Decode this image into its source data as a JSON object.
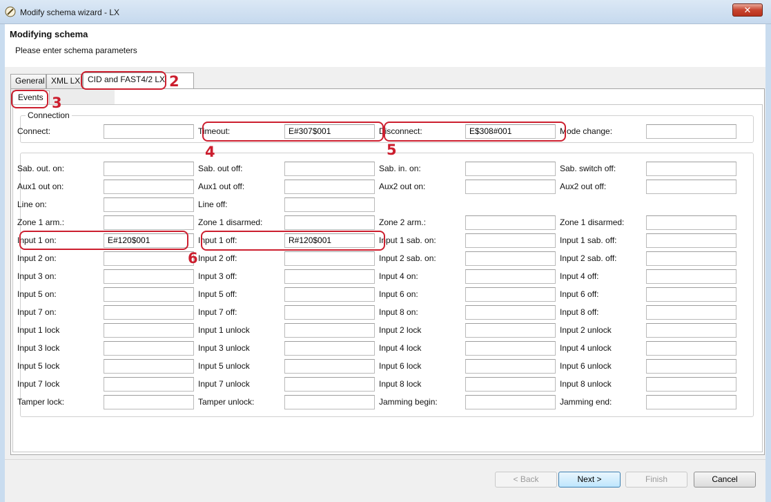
{
  "window": {
    "title": "Modify schema wizard - LX",
    "close_label": "✕"
  },
  "header": {
    "title": "Modifying schema",
    "subtitle": "Please enter schema parameters"
  },
  "tabs": [
    "General",
    "XML LX",
    "CID and FAST4/2 LX"
  ],
  "subtab": "Events",
  "connection": {
    "legend": "Connection",
    "fields": [
      {
        "label": "Connect:",
        "value": ""
      },
      {
        "label": "Timeout:",
        "value": "E#307$001"
      },
      {
        "label": "Disconnect:",
        "value": "E$308#001"
      },
      {
        "label": "Mode change:",
        "value": ""
      }
    ]
  },
  "events": [
    [
      {
        "label": "Sab. out. on:",
        "value": ""
      },
      {
        "label": "Sab. out off:",
        "value": ""
      },
      {
        "label": "Sab. in. on:",
        "value": ""
      },
      {
        "label": "Sab. switch off:",
        "value": ""
      }
    ],
    [
      {
        "label": "Aux1 out on:",
        "value": ""
      },
      {
        "label": "Aux1 out off:",
        "value": ""
      },
      {
        "label": "Aux2 out on:",
        "value": ""
      },
      {
        "label": "Aux2 out off:",
        "value": ""
      }
    ],
    [
      {
        "label": "Line on:",
        "value": ""
      },
      {
        "label": "Line off:",
        "value": ""
      }
    ],
    [
      {
        "label": "Zone 1 arm.:",
        "value": ""
      },
      {
        "label": "Zone 1 disarmed:",
        "value": ""
      },
      {
        "label": "Zone 2 arm.:",
        "value": ""
      },
      {
        "label": "Zone 1 disarmed:",
        "value": ""
      }
    ],
    [
      {
        "label": "Input 1 on:",
        "value": "E#120$001"
      },
      {
        "label": "Input 1 off:",
        "value": "R#120$001"
      },
      {
        "label": "Input 1 sab. on:",
        "value": ""
      },
      {
        "label": "Input 1 sab. off:",
        "value": ""
      }
    ],
    [
      {
        "label": "Input 2 on:",
        "value": ""
      },
      {
        "label": "Input 2 off:",
        "value": ""
      },
      {
        "label": "Input 2 sab. on:",
        "value": ""
      },
      {
        "label": "Input 2 sab. off:",
        "value": ""
      }
    ],
    [
      {
        "label": "Input 3 on:",
        "value": ""
      },
      {
        "label": "Input 3 off:",
        "value": ""
      },
      {
        "label": "Input 4 on:",
        "value": ""
      },
      {
        "label": "Input 4 off:",
        "value": ""
      }
    ],
    [
      {
        "label": "Input 5 on:",
        "value": ""
      },
      {
        "label": "Input 5 off:",
        "value": ""
      },
      {
        "label": "Input 6 on:",
        "value": ""
      },
      {
        "label": "Input 6 off:",
        "value": ""
      }
    ],
    [
      {
        "label": "Input 7 on:",
        "value": ""
      },
      {
        "label": "Input 7 off:",
        "value": ""
      },
      {
        "label": "Input 8 on:",
        "value": ""
      },
      {
        "label": "Input 8 off:",
        "value": ""
      }
    ],
    [
      {
        "label": "Input 1 lock",
        "value": ""
      },
      {
        "label": "Input 1 unlock",
        "value": ""
      },
      {
        "label": "Input 2 lock",
        "value": ""
      },
      {
        "label": "Input 2 unlock",
        "value": ""
      }
    ],
    [
      {
        "label": "Input 3 lock",
        "value": ""
      },
      {
        "label": "Input 3 unlock",
        "value": ""
      },
      {
        "label": "Input 4 lock",
        "value": ""
      },
      {
        "label": "Input 4 unlock",
        "value": ""
      }
    ],
    [
      {
        "label": "Input 5 lock",
        "value": ""
      },
      {
        "label": "Input 5 unlock",
        "value": ""
      },
      {
        "label": "Input 6 lock",
        "value": ""
      },
      {
        "label": "Input 6 unlock",
        "value": ""
      }
    ],
    [
      {
        "label": "Input 7 lock",
        "value": ""
      },
      {
        "label": "Input 7 unlock",
        "value": ""
      },
      {
        "label": "Input 8 lock",
        "value": ""
      },
      {
        "label": "Input 8 unlock",
        "value": ""
      }
    ],
    [
      {
        "label": "Tamper lock:",
        "value": ""
      },
      {
        "label": "Tamper unlock:",
        "value": ""
      },
      {
        "label": "Jamming begin:",
        "value": ""
      },
      {
        "label": "Jamming end:",
        "value": ""
      }
    ]
  ],
  "annotations": [
    "2",
    "3",
    "4",
    "5",
    "6"
  ],
  "buttons": {
    "back": "< Back",
    "next": "Next >",
    "finish": "Finish",
    "cancel": "Cancel"
  },
  "colors": {
    "annotation": "#cc1e2e",
    "window_frame": "#c9dcef"
  },
  "icons": {
    "app": "pencil-circle-icon"
  }
}
